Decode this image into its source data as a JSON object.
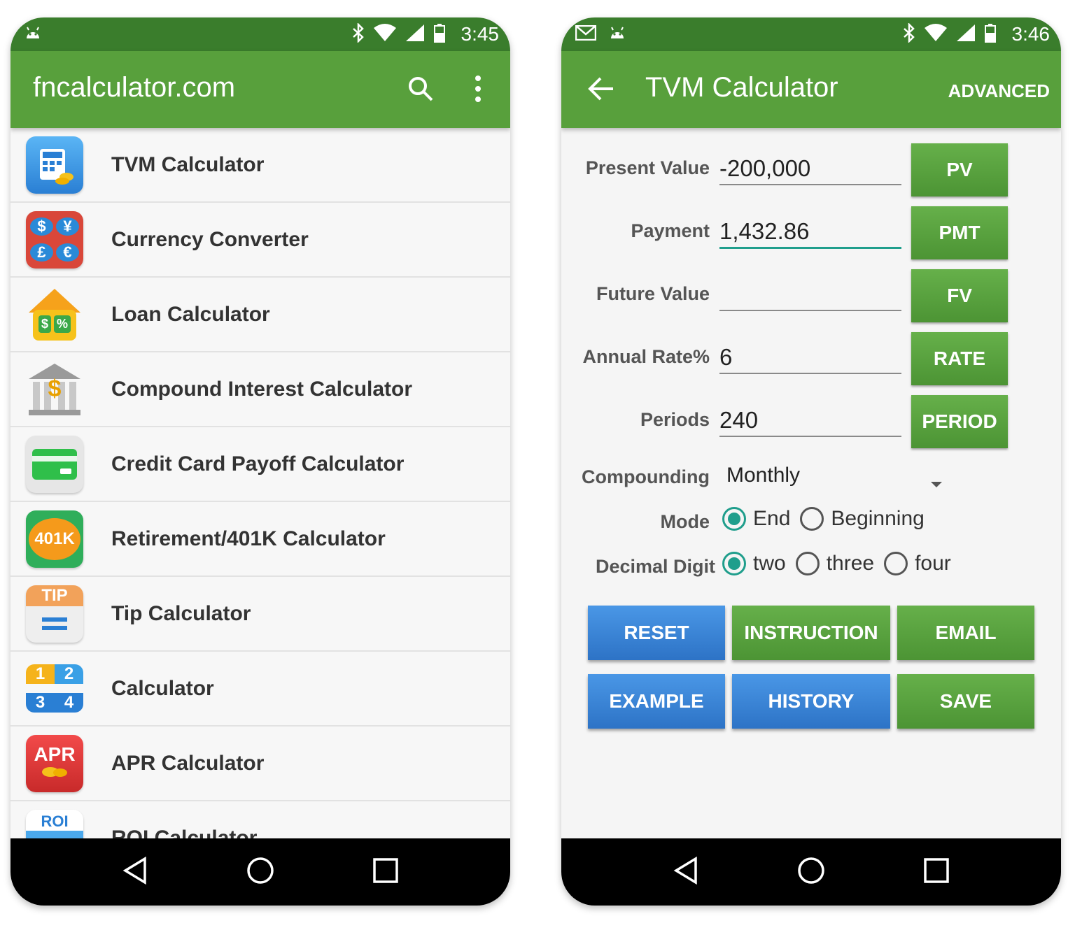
{
  "left": {
    "status": {
      "time": "3:45"
    },
    "appbar": {
      "title": "fncalculator.com"
    },
    "items": [
      {
        "label": "TVM Calculator",
        "icon": "tvm-calculator-icon"
      },
      {
        "label": "Currency Converter",
        "icon": "currency-converter-icon",
        "glyphs": [
          "$",
          "¥",
          "£",
          "€"
        ]
      },
      {
        "label": "Loan Calculator",
        "icon": "loan-house-icon",
        "glyphs": [
          "$",
          "%"
        ]
      },
      {
        "label": "Compound Interest Calculator",
        "icon": "bank-icon",
        "glyph": "$"
      },
      {
        "label": "Credit Card Payoff Calculator",
        "icon": "credit-card-icon"
      },
      {
        "label": "Retirement/401K Calculator",
        "icon": "retirement-401k-icon",
        "glyph": "401K"
      },
      {
        "label": "Tip Calculator",
        "icon": "tip-icon",
        "glyph": "TIP"
      },
      {
        "label": "Calculator",
        "icon": "calculator-icon",
        "glyphs": [
          "1",
          "2",
          "3",
          "4"
        ]
      },
      {
        "label": "APR Calculator",
        "icon": "apr-icon",
        "glyph": "APR"
      },
      {
        "label": "ROI Calculator",
        "icon": "roi-icon",
        "glyph": "ROI"
      }
    ]
  },
  "right": {
    "status": {
      "time": "3:46"
    },
    "appbar": {
      "title": "TVM Calculator",
      "action": "ADVANCED"
    },
    "fields": [
      {
        "label": "Present Value",
        "value": "-200,000",
        "button": "PV"
      },
      {
        "label": "Payment",
        "value": "1,432.86",
        "button": "PMT"
      },
      {
        "label": "Future Value",
        "value": "",
        "button": "FV"
      },
      {
        "label": "Annual Rate%",
        "value": "6",
        "button": "RATE"
      },
      {
        "label": "Periods",
        "value": "240",
        "button": "PERIOD"
      }
    ],
    "compounding": {
      "label": "Compounding",
      "value": "Monthly"
    },
    "mode": {
      "label": "Mode",
      "options": [
        "End",
        "Beginning"
      ],
      "selected": "End"
    },
    "decimal": {
      "label": "Decimal Digit",
      "options": [
        "two",
        "three",
        "four"
      ],
      "selected": "two"
    },
    "buttons": {
      "reset": "RESET",
      "instruction": "INSTRUCTION",
      "email": "EMAIL",
      "example": "EXAMPLE",
      "history": "HISTORY",
      "save": "SAVE"
    }
  },
  "colors": {
    "status": "#3a7d2c",
    "appbar": "#58a03c",
    "accent": "#1f9e8c",
    "blue_button": "#2d73c6",
    "green_button": "#4c9434"
  }
}
